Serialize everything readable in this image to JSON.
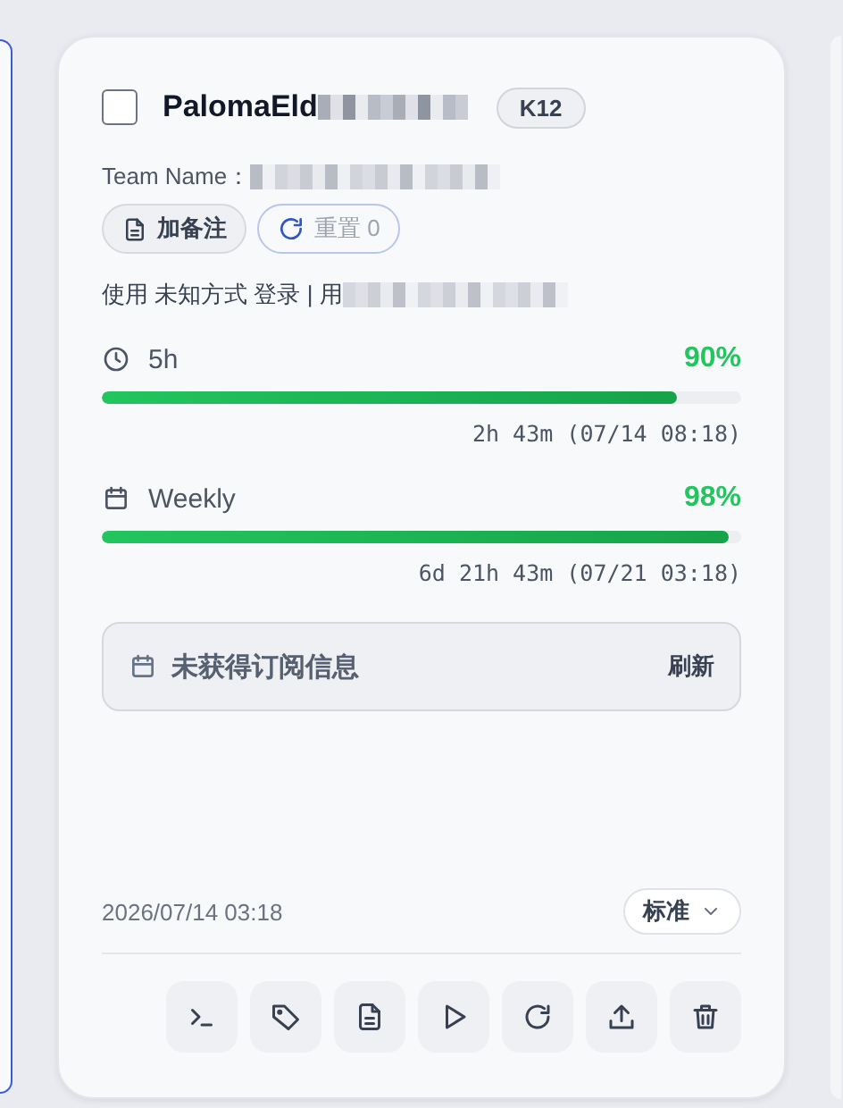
{
  "account": {
    "checked": false,
    "name": "PalomaEld",
    "badge": "K12"
  },
  "team_label": "Team Name：",
  "actions": [
    {
      "kind": "note",
      "label": "加备注"
    },
    {
      "kind": "reset",
      "label": "重置 0"
    }
  ],
  "login_info": "使用 未知方式 登录 | 用",
  "limits": [
    {
      "kind": "clock",
      "label": "5h",
      "percent": "90%",
      "level": 0.9,
      "reset": "2h 43m (07/14 08:18)"
    },
    {
      "kind": "calendar",
      "label": "Weekly",
      "percent": "98%",
      "level": 0.98,
      "reset": "6d 21h 43m (07/21 03:18)"
    }
  ],
  "subscription": {
    "message": "未获得订阅信息",
    "action": "刷新"
  },
  "footer": {
    "timestamp": "2026/07/14 03:18",
    "plan": "标准"
  },
  "toolbar": [
    {
      "kind": "terminal"
    },
    {
      "kind": "tag"
    },
    {
      "kind": "document"
    },
    {
      "kind": "play"
    },
    {
      "kind": "refresh"
    },
    {
      "kind": "upload"
    },
    {
      "kind": "delete"
    }
  ]
}
